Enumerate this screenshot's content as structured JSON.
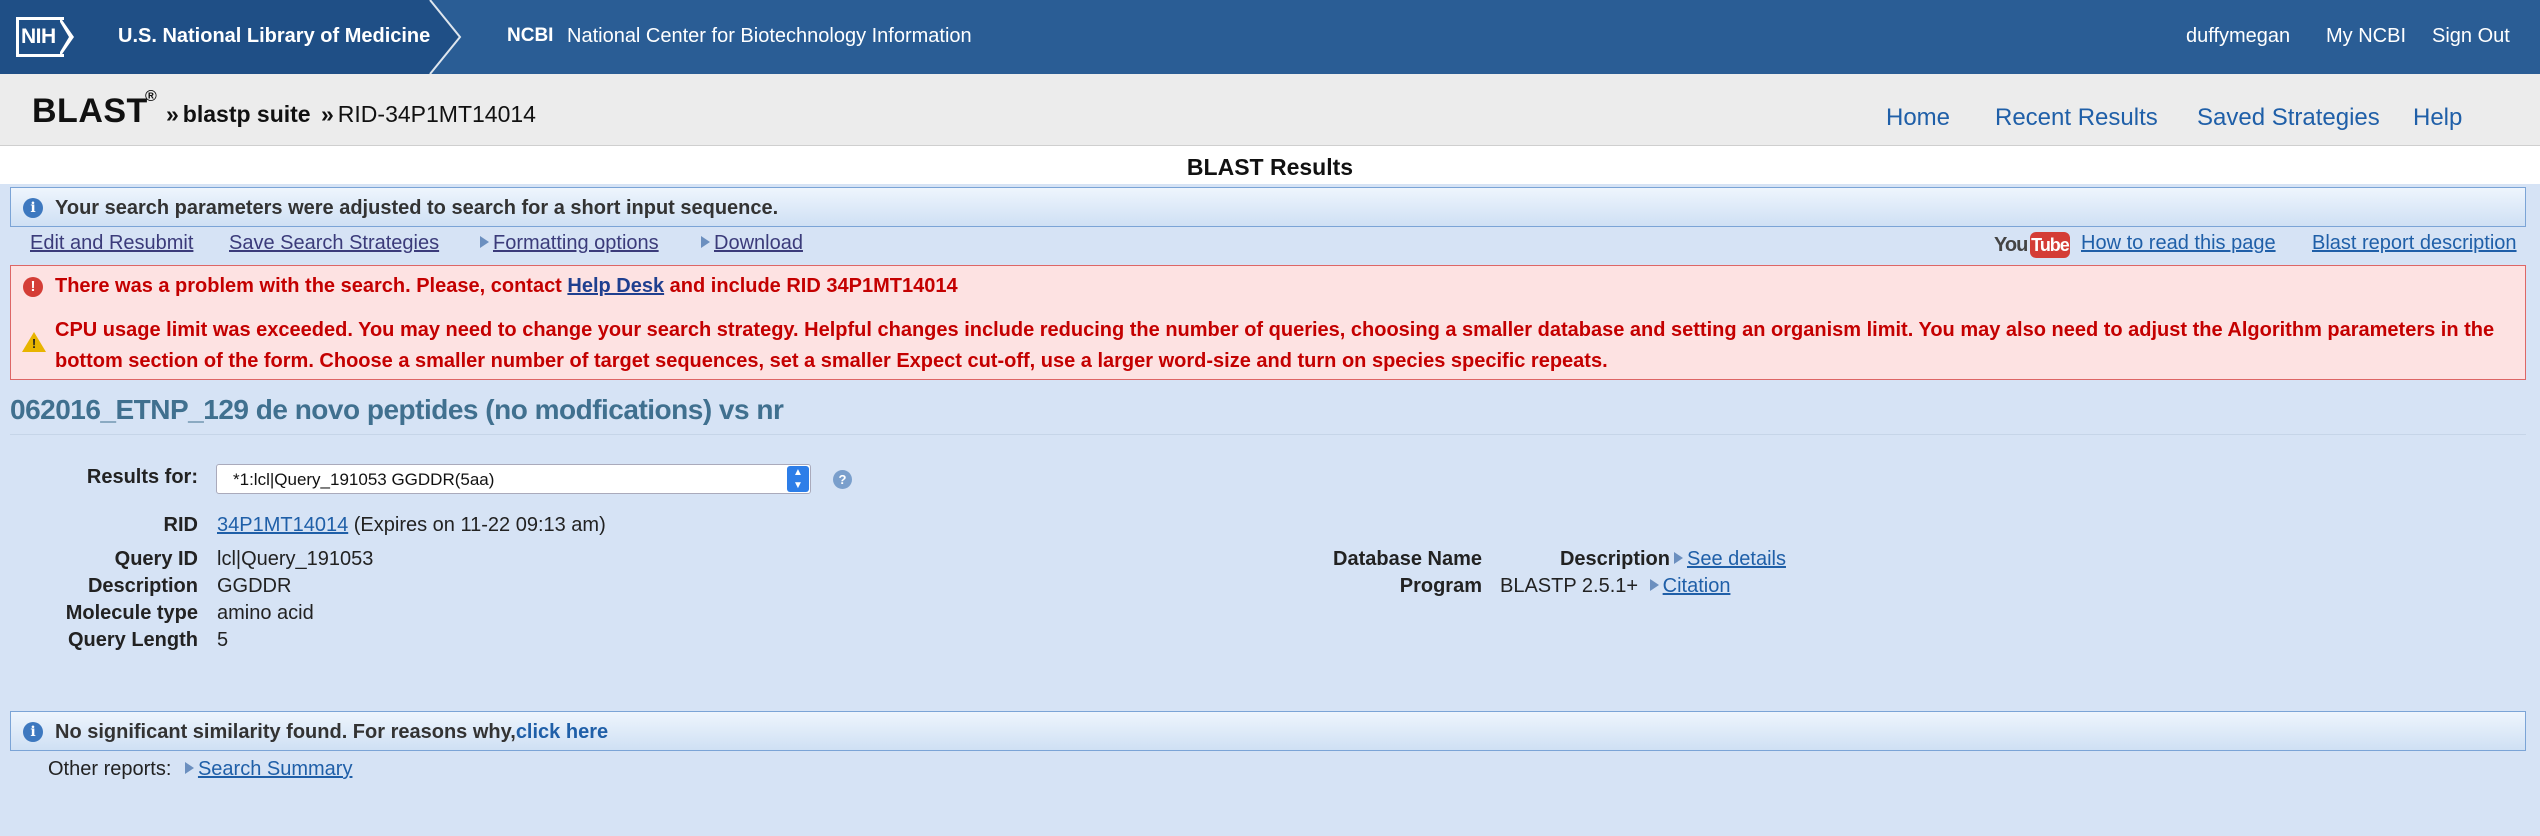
{
  "nih": {
    "logo": "NIH",
    "nlm": "U.S. National Library of Medicine",
    "ncbi_abbr": "NCBI",
    "ncbi_full": "National Center for Biotechnology Information",
    "user": "duffymegan",
    "my_ncbi": "My NCBI",
    "sign_out": "Sign Out"
  },
  "blast_header": {
    "logo": "BLAST",
    "registered": "®",
    "sep1": "»",
    "suite": "blastp suite",
    "sep2": "»",
    "rid": "RID-34P1MT14014",
    "nav": {
      "home": "Home",
      "recent": "Recent Results",
      "saved": "Saved Strategies",
      "help": "Help"
    }
  },
  "results_title": "BLAST Results",
  "notice_top": "Your search parameters were adjusted to search for a short input sequence.",
  "toolbar": {
    "edit": "Edit and Resubmit",
    "save": "Save Search Strategies",
    "formatting": "Formatting options",
    "download": "Download",
    "yt_you": "You",
    "yt_tube": "Tube",
    "how_to_read": "How to read this page",
    "report_description": "Blast report description"
  },
  "error": {
    "line1_pre": "There was a problem with the search. Please, contact ",
    "help_desk": "Help Desk",
    "line1_post": " and include RID 34P1MT14014",
    "line2": "CPU usage limit was exceeded. You may need to change your search strategy. Helpful changes include reducing the number of queries, choosing a smaller database and setting an organism limit. You may also need to adjust the Algorithm parameters in the bottom section of the form. Choose a smaller number of target sequences, set a smaller Expect cut-off, use a larger word-size and turn on species specific repeats."
  },
  "search_title": "062016_ETNP_129 de novo peptides (no modfications) vs nr",
  "summary": {
    "results_for_label": "Results for:",
    "results_for_value": "*1:lcl|Query_191053 GGDDR(5aa)",
    "rid_label": "RID",
    "rid_value": "34P1MT14014",
    "rid_expires": "(Expires on 11-22 09:13 am)",
    "query_id_label": "Query ID",
    "query_id_value": "lcl|Query_191053",
    "description_label": "Description",
    "description_value": "GGDDR",
    "molecule_label": "Molecule type",
    "molecule_value": "amino acid",
    "length_label": "Query Length",
    "length_value": "5",
    "db_name_label": "Database Name",
    "db_desc_label": "Description",
    "see_details": "See details",
    "program_label": "Program",
    "program_value": "BLASTP 2.5.1+",
    "citation": "Citation"
  },
  "no_similarity": {
    "text": "No significant similarity found. For reasons why,",
    "link": "click here"
  },
  "other_reports": {
    "label": "Other reports:",
    "search_summary": "Search Summary"
  }
}
